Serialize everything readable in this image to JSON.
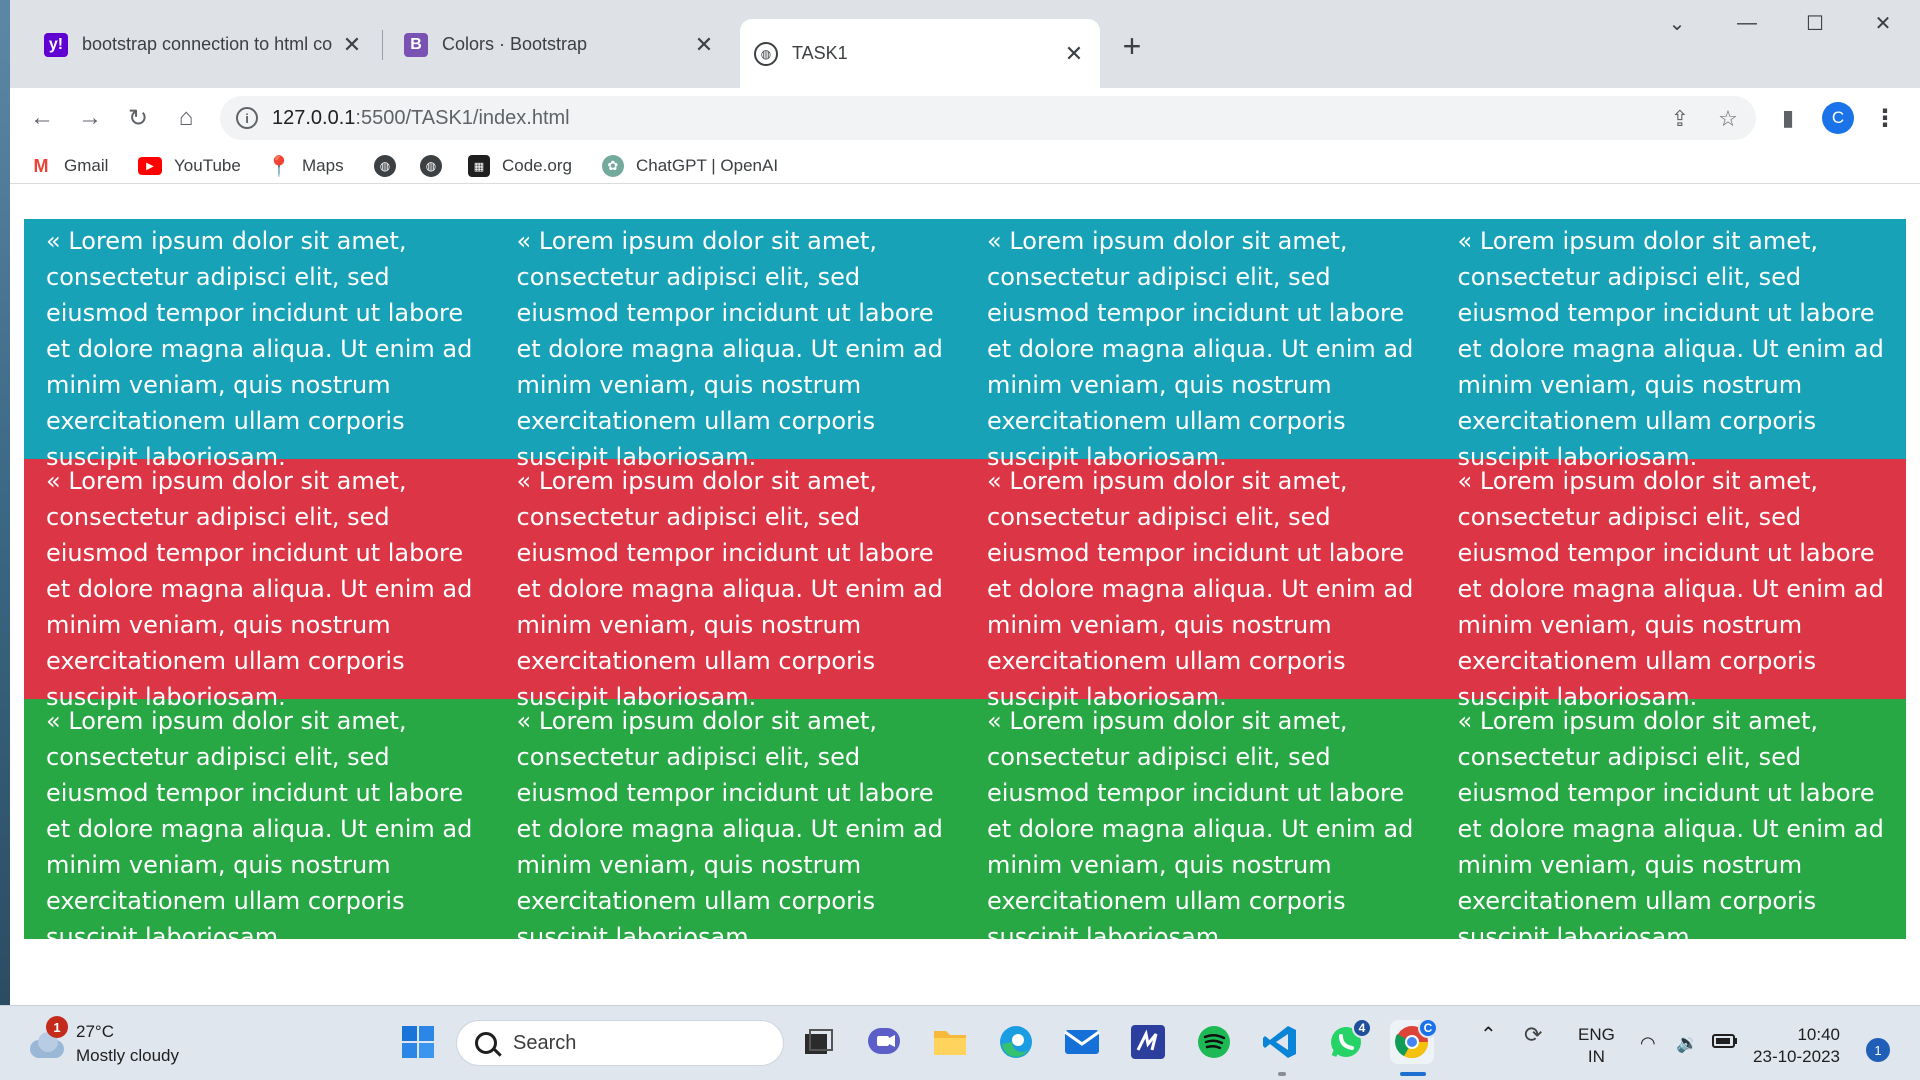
{
  "browser": {
    "tabs": [
      {
        "title": "bootstrap connection to html co",
        "favicon": "yahoo-icon",
        "favicon_letter": "y!",
        "favicon_color": "#6001d2",
        "active": false
      },
      {
        "title": "Colors · Bootstrap",
        "favicon": "bootstrap-icon",
        "favicon_letter": "B",
        "favicon_color": "#7952b3",
        "active": false
      },
      {
        "title": "TASK1",
        "favicon": "globe-icon",
        "active": true
      }
    ],
    "url": {
      "host": "127.0.0.1",
      "rest": ":5500/TASK1/index.html"
    },
    "profile_initial": "C",
    "bookmarks": [
      {
        "label": "Gmail",
        "icon": "gmail-icon"
      },
      {
        "label": "YouTube",
        "icon": "youtube-icon"
      },
      {
        "label": "Maps",
        "icon": "maps-icon"
      },
      {
        "label": "",
        "icon": "globe-icon"
      },
      {
        "label": "",
        "icon": "globe-icon"
      },
      {
        "label": "Code.org",
        "icon": "codeorg-icon"
      },
      {
        "label": "ChatGPT | OpenAI",
        "icon": "openai-icon"
      }
    ]
  },
  "page": {
    "cell_text": "« Lorem ipsum dolor sit amet, consectetur adipisci elit, sed eiusmod tempor incidunt ut labore et dolore magna aliqua. Ut enim ad minim veniam, quis nostrum exercitationem ullam corporis suscipit laboriosam.",
    "rows": [
      {
        "color": "#17a2b8",
        "cells": 4
      },
      {
        "color": "#dc3545",
        "cells": 4
      },
      {
        "color": "#28a745",
        "cells": 4
      }
    ]
  },
  "taskbar": {
    "weather": {
      "temp": "27°C",
      "condition": "Mostly cloudy",
      "badge": "1"
    },
    "search_placeholder": "Search",
    "whatsapp_badge": "4",
    "language": {
      "line1": "ENG",
      "line2": "IN"
    },
    "clock": {
      "time": "10:40",
      "date": "23-10-2023"
    },
    "notification_count": "1"
  }
}
